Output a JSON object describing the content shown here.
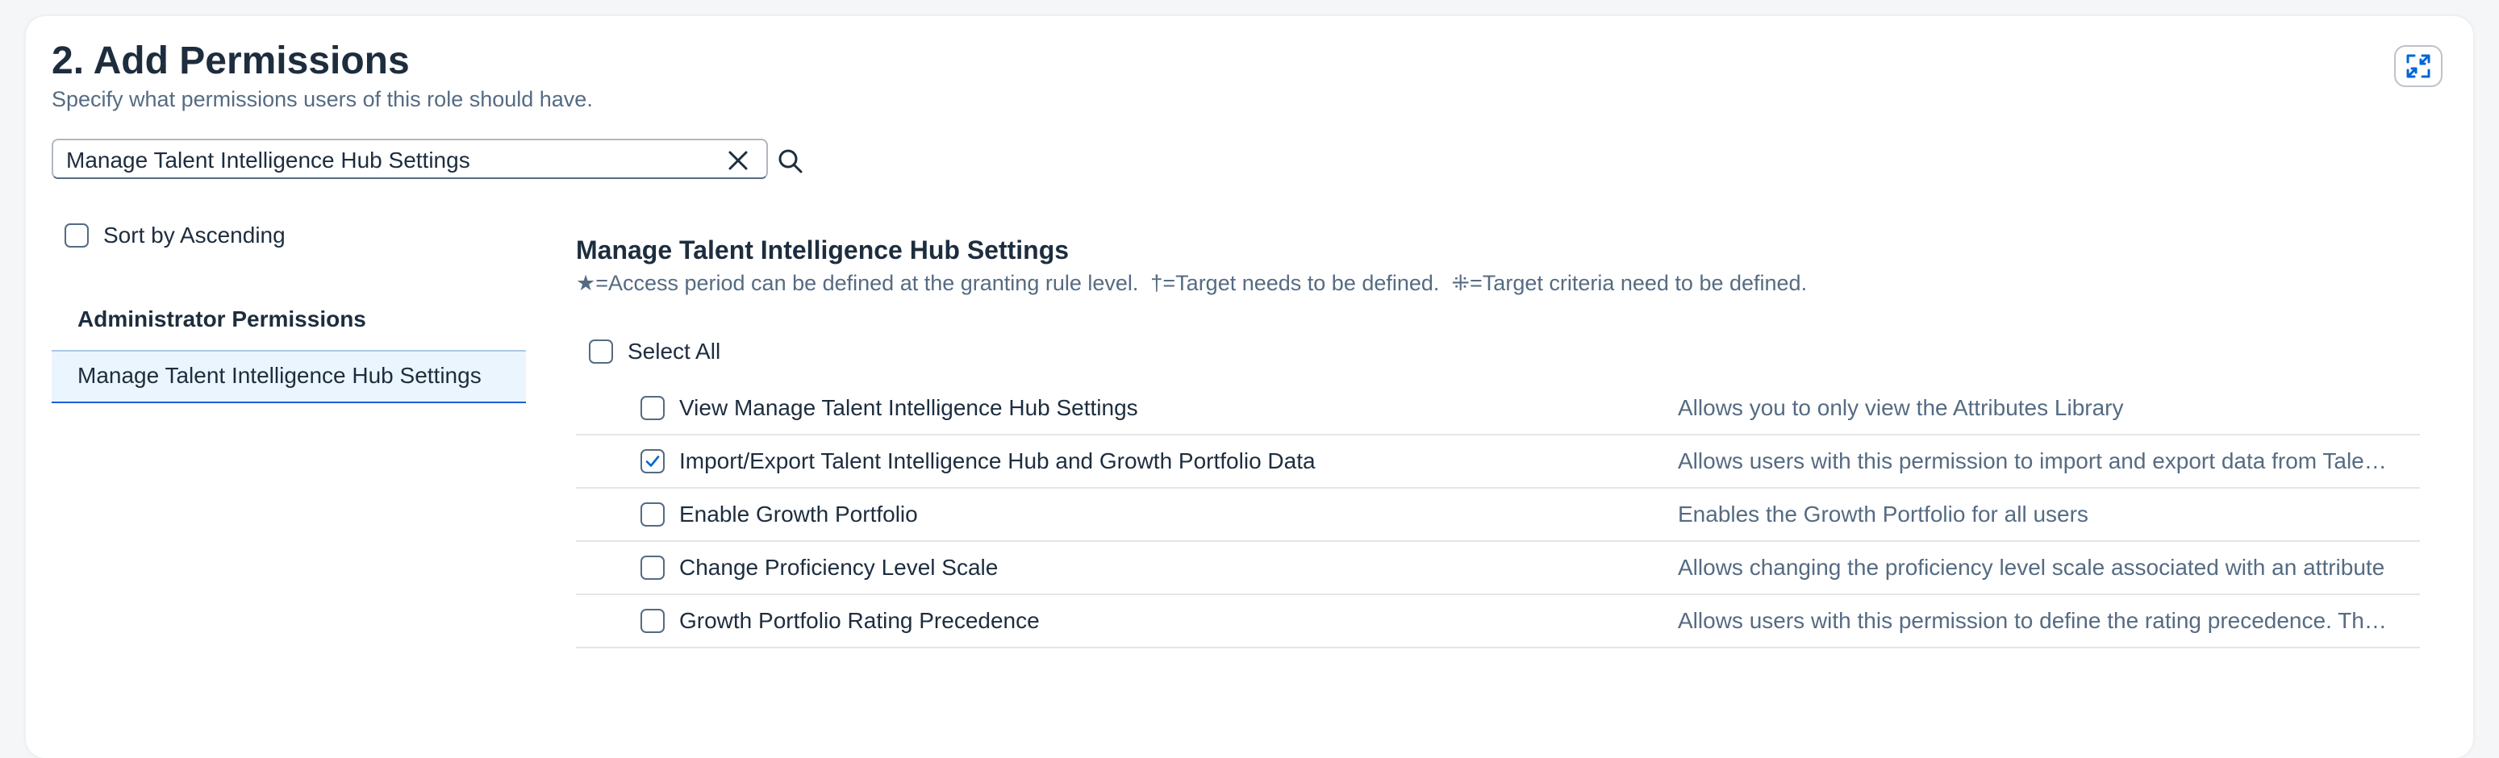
{
  "header": {
    "title": "2. Add Permissions",
    "subtitle": "Specify what permissions users of this role should have."
  },
  "search": {
    "value": "Manage Talent Intelligence Hub Settings"
  },
  "sidebar": {
    "sort_label": "Sort by Ascending",
    "sort_checked": false,
    "group_title": "Administrator Permissions",
    "items": [
      {
        "label": "Manage Talent Intelligence Hub Settings",
        "selected": true
      }
    ]
  },
  "main": {
    "section_title": "Manage Talent Intelligence Hub Settings",
    "legend": "★=Access period can be defined at the granting rule level.  †=Target needs to be defined.  ⁜=Target criteria need to be defined.",
    "select_all_label": "Select All",
    "permissions": [
      {
        "name": "View Manage Talent Intelligence Hub Settings",
        "description": "Allows you to only view the Attributes Library",
        "checked": false
      },
      {
        "name": "Import/Export Talent Intelligence Hub and Growth Portfolio Data",
        "description": "Allows users with this permission to import and export data from Talent Intelligence Hub and Growth Portfolio",
        "checked": true
      },
      {
        "name": "Enable Growth Portfolio",
        "description": "Enables the Growth Portfolio for all users",
        "checked": false
      },
      {
        "name": "Change Proficiency Level Scale",
        "description": "Allows changing the proficiency level scale associated with an attribute",
        "checked": false
      },
      {
        "name": "Growth Portfolio Rating Precedence",
        "description": "Allows users with this permission to define the rating precedence. The rating precedence determines which rating is displayed",
        "checked": false
      }
    ]
  },
  "colors": {
    "accent": "#0064d9",
    "text": "#1d2d3e",
    "secondary_text": "#556b82",
    "selected_bg": "#ebf5fe"
  },
  "icons": {
    "fullscreen": "exit-full-screen-icon",
    "clear": "close-icon",
    "search": "search-icon",
    "check": "checkmark-icon"
  }
}
